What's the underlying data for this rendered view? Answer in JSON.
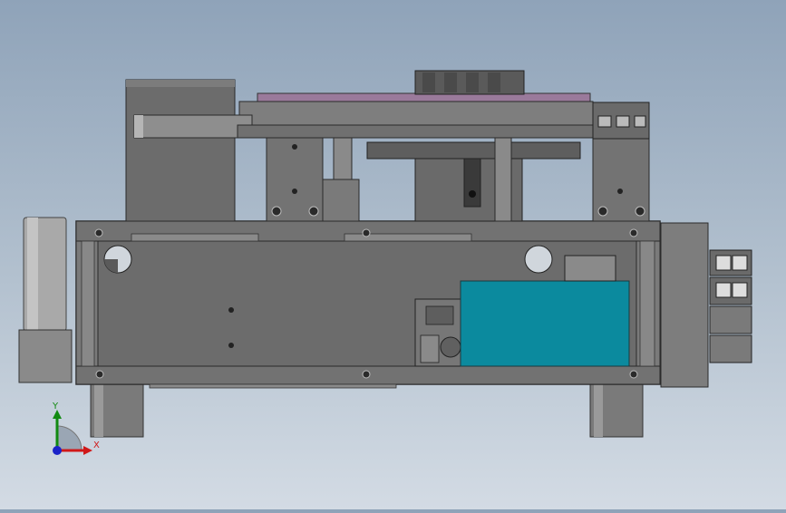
{
  "viewport": {
    "background_top": "#8fa3b9",
    "background_bottom": "#d3dbe4"
  },
  "model": {
    "body_color": "#6f6f6f",
    "frame_color": "#5e5e5e",
    "plate_color": "#8a8a8a",
    "accent_plate_color": "#9a7a9b",
    "teal_block_color": "#0b8a9e"
  },
  "triad": {
    "x_label": "X",
    "y_label": "Y",
    "x_color": "#d01818",
    "y_color": "#118a11",
    "z_color": "#1a22c8"
  }
}
